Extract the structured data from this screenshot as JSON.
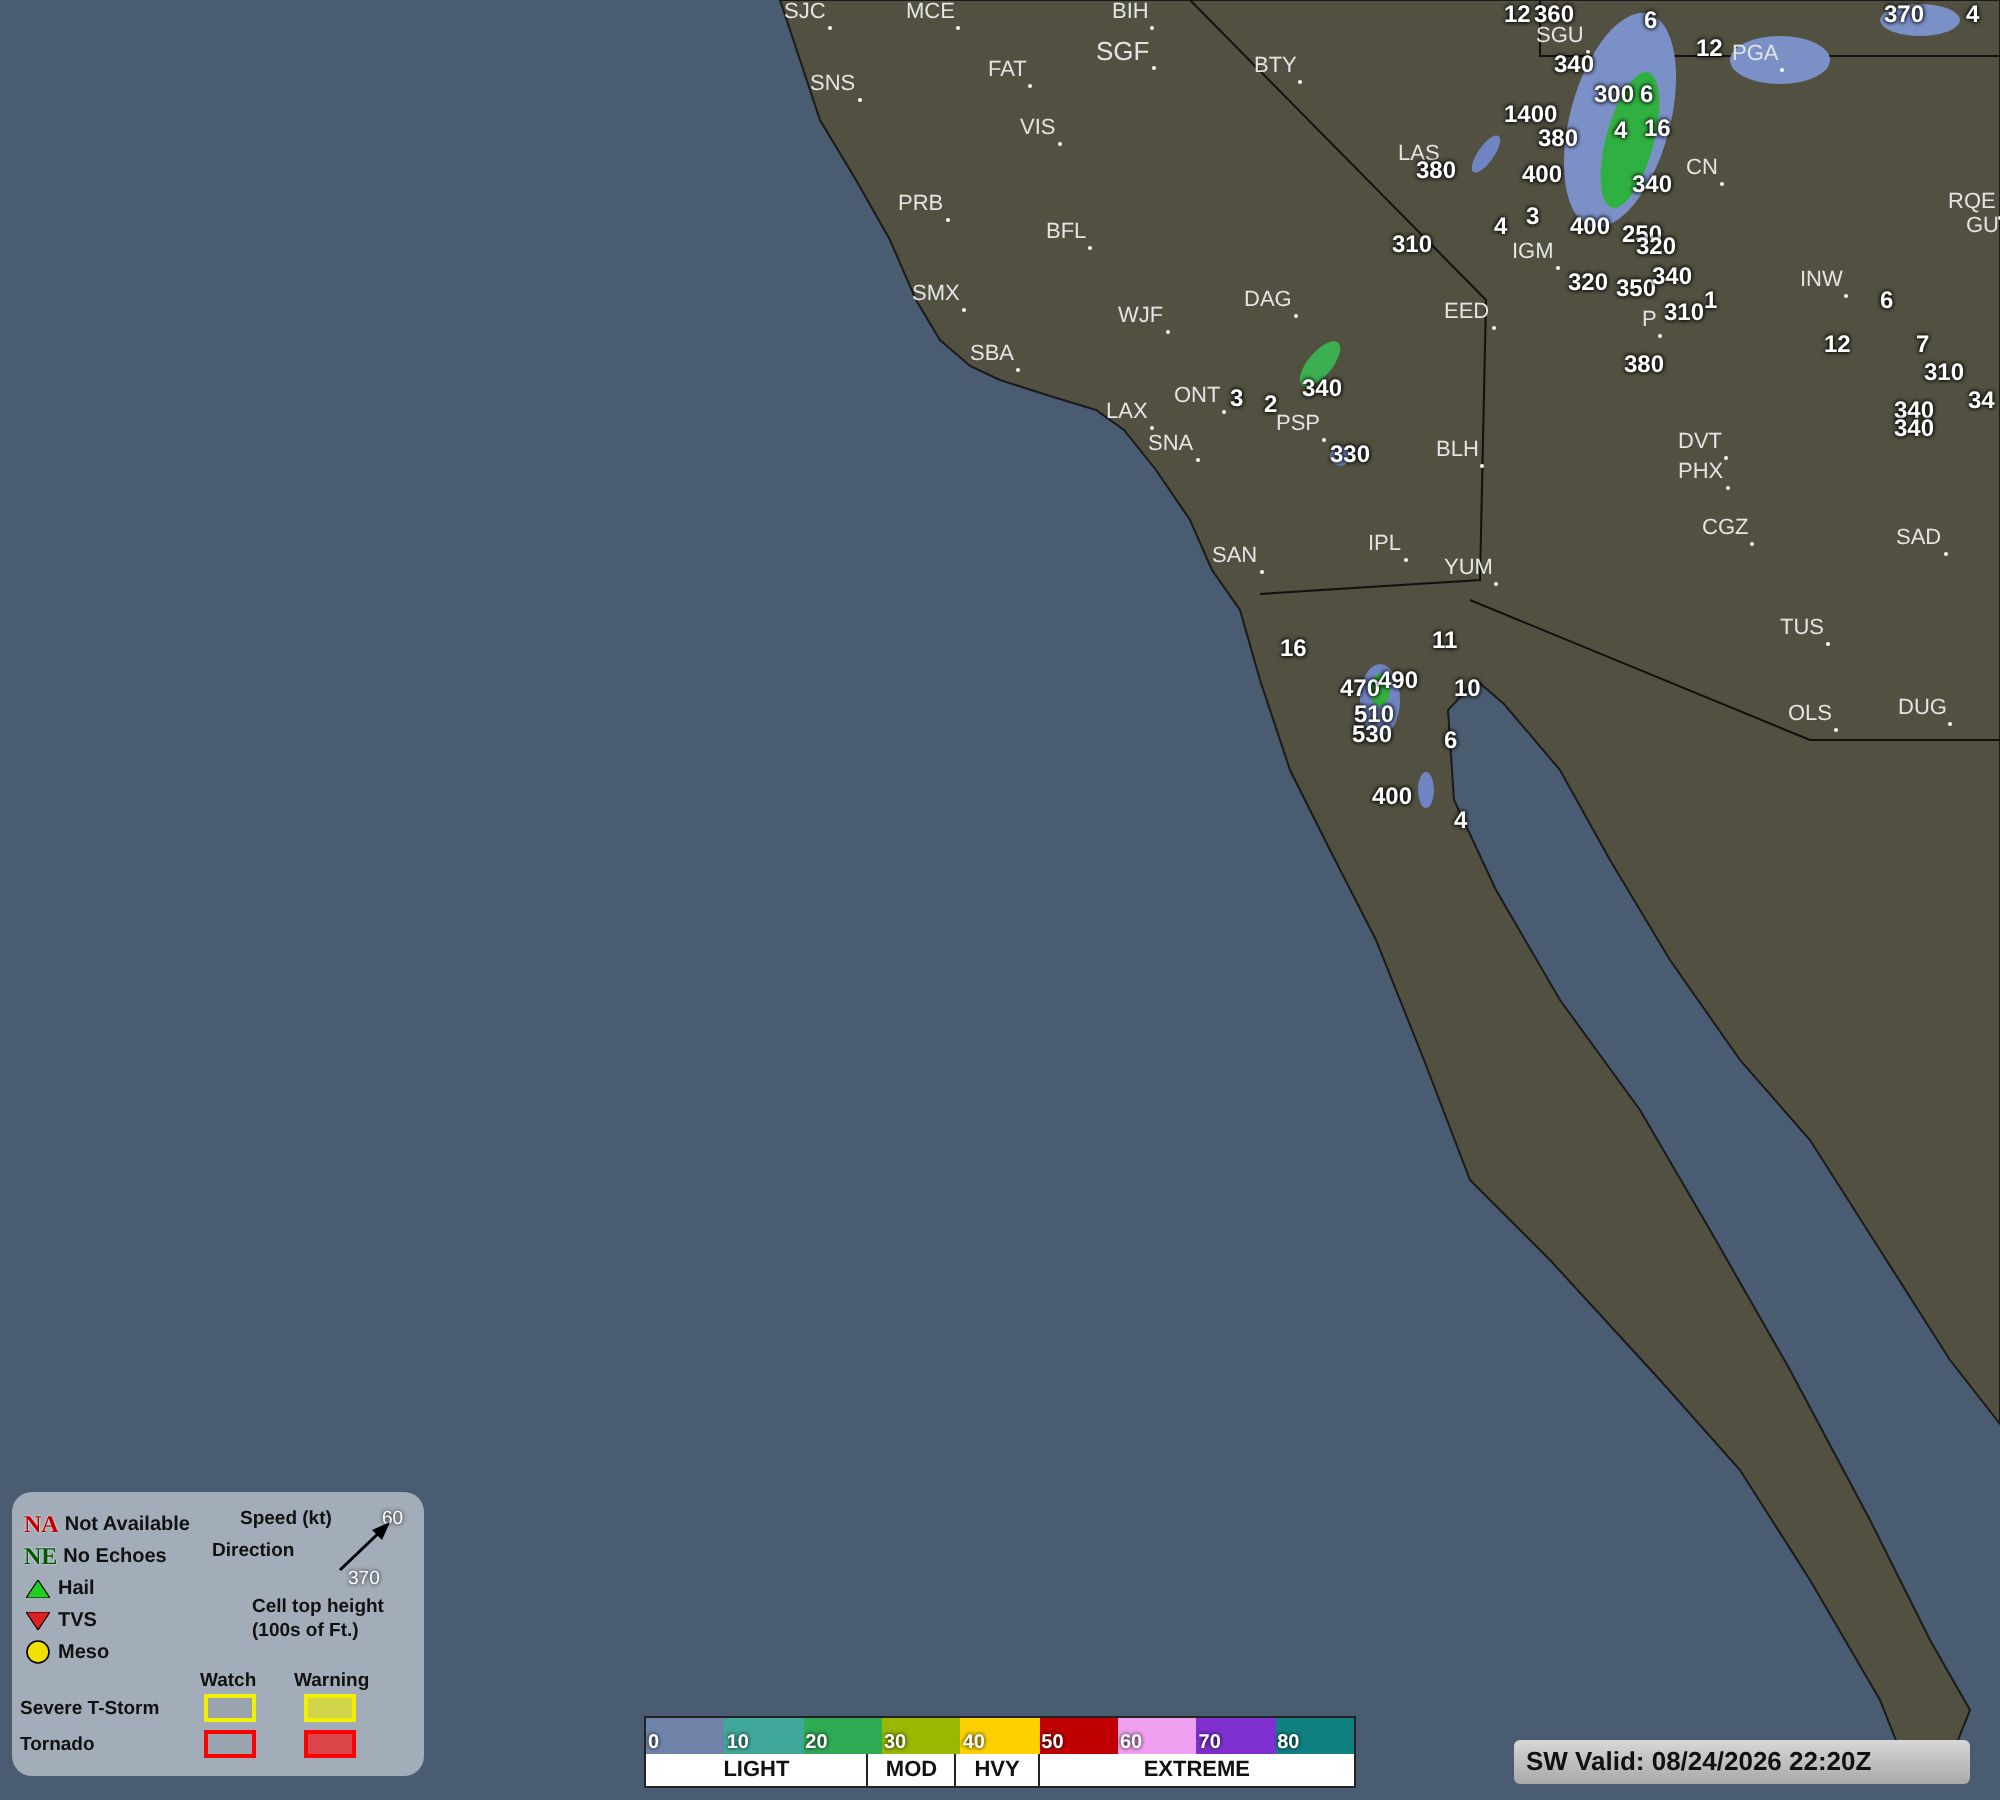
{
  "map": {
    "stations": [
      {
        "code": "SJC"
      },
      {
        "code": "MCE"
      },
      {
        "code": "BIH"
      },
      {
        "code": "SGF"
      },
      {
        "code": "FAT"
      },
      {
        "code": "BTY"
      },
      {
        "code": "SNS"
      },
      {
        "code": "VIS"
      },
      {
        "code": "PRB"
      },
      {
        "code": "BFL"
      },
      {
        "code": "SMX"
      },
      {
        "code": "DAG"
      },
      {
        "code": "WJF"
      },
      {
        "code": "EED"
      },
      {
        "code": "SBA"
      },
      {
        "code": "LAX"
      },
      {
        "code": "ONT"
      },
      {
        "code": "PSP"
      },
      {
        "code": "SNA"
      },
      {
        "code": "BLH"
      },
      {
        "code": "LAS"
      },
      {
        "code": "IGM"
      },
      {
        "code": "SGU"
      },
      {
        "code": "PGA"
      },
      {
        "code": "CN"
      },
      {
        "code": "RQE"
      },
      {
        "code": "GU"
      },
      {
        "code": "INW"
      },
      {
        "code": "P"
      },
      {
        "code": "DVT"
      },
      {
        "code": "PHX"
      },
      {
        "code": "CGZ"
      },
      {
        "code": "SAD"
      },
      {
        "code": "TUS"
      },
      {
        "code": "IPL"
      },
      {
        "code": "YUM"
      },
      {
        "code": "SAN"
      },
      {
        "code": "OLS"
      },
      {
        "code": "DUG"
      }
    ],
    "storm_cells": [
      {
        "label": "12"
      },
      {
        "label": "360"
      },
      {
        "label": "6"
      },
      {
        "label": "370"
      },
      {
        "label": "4"
      },
      {
        "label": "12"
      },
      {
        "label": "340"
      },
      {
        "label": "300"
      },
      {
        "label": "6"
      },
      {
        "label": "1400"
      },
      {
        "label": "380"
      },
      {
        "label": "4"
      },
      {
        "label": "16"
      },
      {
        "label": "400"
      },
      {
        "label": "340"
      },
      {
        "label": "4"
      },
      {
        "label": "3"
      },
      {
        "label": "400"
      },
      {
        "label": "250"
      },
      {
        "label": "320"
      },
      {
        "label": "320"
      },
      {
        "label": "350"
      },
      {
        "label": "340"
      },
      {
        "label": "310"
      },
      {
        "label": "1"
      },
      {
        "label": "380"
      },
      {
        "label": "6"
      },
      {
        "label": "12"
      },
      {
        "label": "7"
      },
      {
        "label": "310"
      },
      {
        "label": "340"
      },
      {
        "label": "340"
      },
      {
        "label": "34"
      },
      {
        "label": "310"
      },
      {
        "label": "380"
      },
      {
        "label": "340"
      },
      {
        "label": "3"
      },
      {
        "label": "2"
      },
      {
        "label": "330"
      },
      {
        "label": "16"
      },
      {
        "label": "11"
      },
      {
        "label": "470"
      },
      {
        "label": "490"
      },
      {
        "label": "10"
      },
      {
        "label": "510"
      },
      {
        "label": "530"
      },
      {
        "label": "6"
      },
      {
        "label": "400"
      },
      {
        "label": "4"
      }
    ]
  },
  "legend": {
    "symbols": [
      {
        "kind": "na",
        "badge": "NA",
        "label": "Not Available"
      },
      {
        "kind": "ne",
        "badge": "NE",
        "label": "No Echoes"
      },
      {
        "kind": "hail",
        "label": "Hail"
      },
      {
        "kind": "tvs",
        "label": "TVS"
      },
      {
        "kind": "meso",
        "label": "Meso"
      }
    ],
    "key": {
      "speed": "Speed (kt)",
      "speed_value": "60",
      "direction": "Direction",
      "height_value": "370",
      "height": "Cell top height",
      "height_unit": "(100s of Ft.)"
    },
    "watch_header": "Watch",
    "warning_header": "Warning",
    "alerts": [
      {
        "label": "Severe T-Storm",
        "color": "#f0f000"
      },
      {
        "label": "Tornado",
        "color": "#ff0000"
      }
    ]
  },
  "scale": {
    "ticks": [
      "0",
      "10",
      "20",
      "30",
      "40",
      "50",
      "60",
      "70",
      "80"
    ],
    "bands": [
      {
        "label": "LIGHT"
      },
      {
        "label": "MOD"
      },
      {
        "label": "HVY"
      },
      {
        "label": "EXTREME"
      }
    ]
  },
  "valid": "SW Valid: 08/24/2026 22:20Z"
}
